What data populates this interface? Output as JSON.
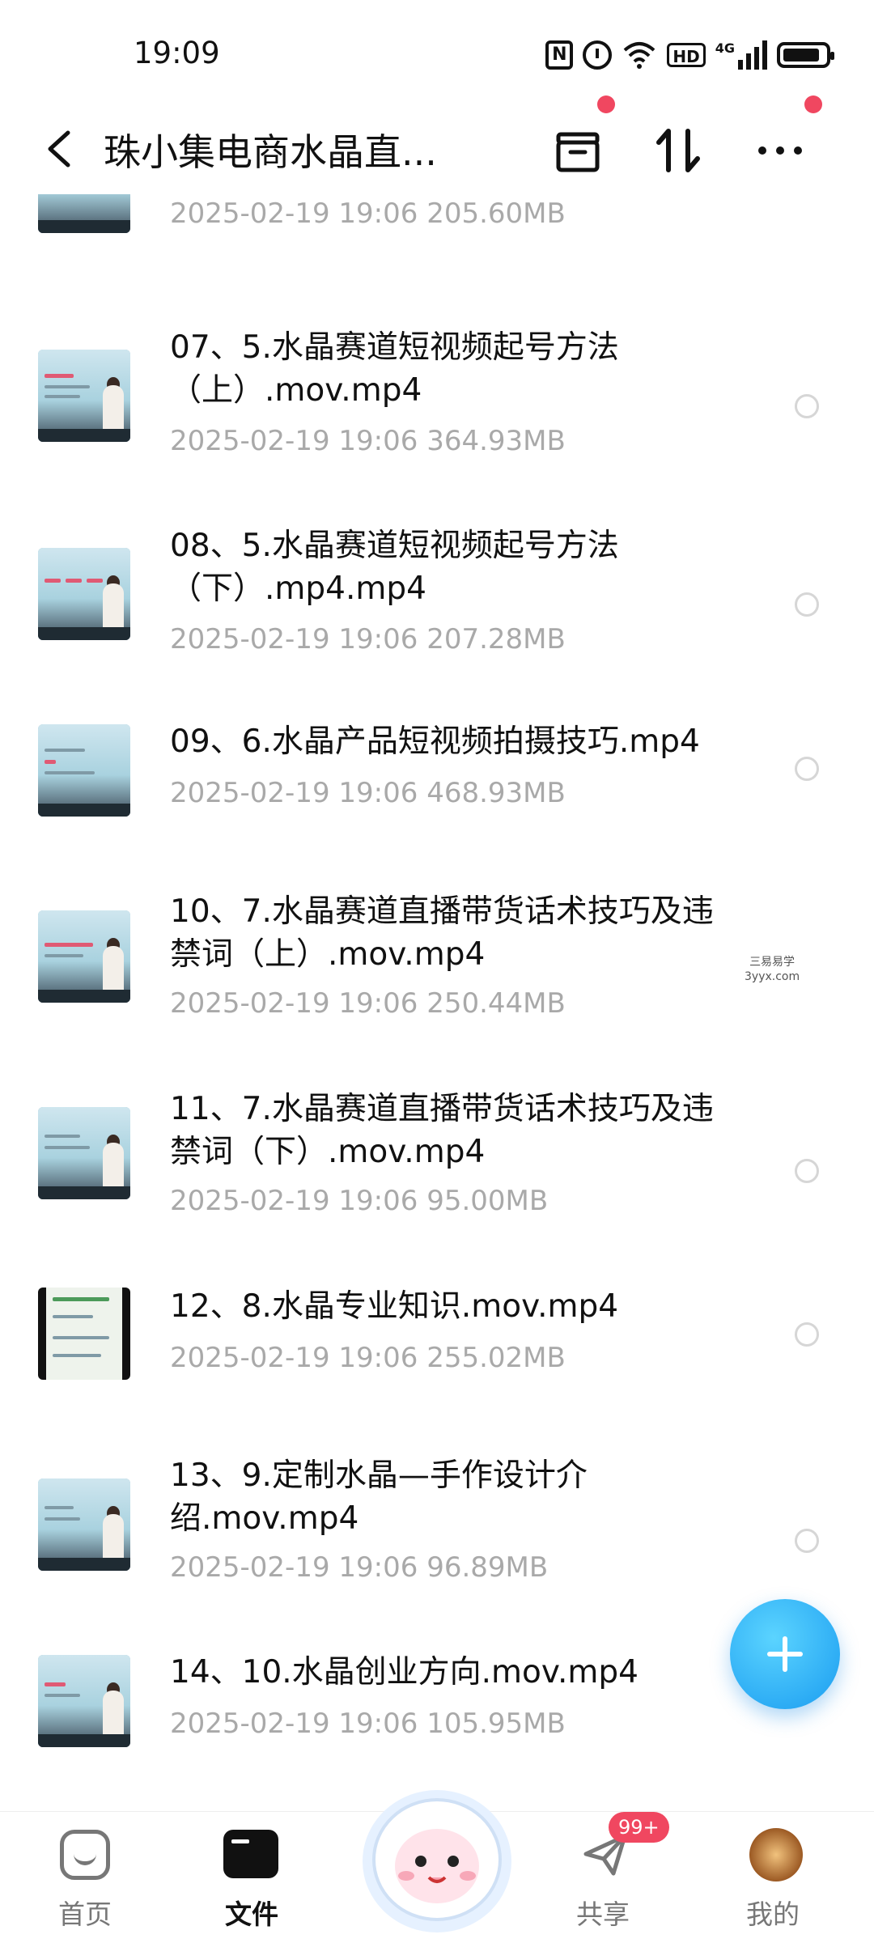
{
  "status_bar": {
    "time": "19:09",
    "icons": [
      "nfc-icon",
      "alarm-icon",
      "wifi-icon",
      "hd-icon",
      "signal-4g-icon",
      "battery-icon"
    ],
    "network_label": "4G",
    "hd_label": "HD"
  },
  "header": {
    "title": "珠小集电商水晶直...",
    "icons": [
      "back-arrow-icon",
      "archive-box-icon",
      "sort-icon",
      "more-icon"
    ]
  },
  "files": [
    {
      "name": "",
      "meta": "2025-02-19  19:06   205.60MB"
    },
    {
      "name": "07、5.水晶赛道短视频起号方法（上）.mov.mp4",
      "meta": "2025-02-19  19:06   364.93MB"
    },
    {
      "name": "08、5.水晶赛道短视频起号方法（下）.mp4.mp4",
      "meta": "2025-02-19  19:06   207.28MB"
    },
    {
      "name": "09、6.水晶产品短视频拍摄技巧.mp4",
      "meta": "2025-02-19  19:06   468.93MB"
    },
    {
      "name": "10、7.水晶赛道直播带货话术技巧及违禁词（上）.mov.mp4",
      "meta": "2025-02-19  19:06   250.44MB"
    },
    {
      "name": "11、7.水晶赛道直播带货话术技巧及违禁词（下）.mov.mp4",
      "meta": "2025-02-19  19:06   95.00MB"
    },
    {
      "name": "12、8.水晶专业知识.mov.mp4",
      "meta": "2025-02-19  19:06   255.02MB"
    },
    {
      "name": "13、9.定制水晶—手作设计介绍.mov.mp4",
      "meta": "2025-02-19  19:06   96.89MB"
    },
    {
      "name": "14、10.水晶创业方向.mov.mp4",
      "meta": "2025-02-19  19:06   105.95MB"
    }
  ],
  "watermark": {
    "line1": "三易易学",
    "line2": "3yyx.com"
  },
  "fab": {
    "icon": "plus-icon"
  },
  "bottom_nav": {
    "home": "首页",
    "files": "文件",
    "share": "共享",
    "share_badge": "99+",
    "me": "我的"
  },
  "colors": {
    "accent": "#1a9cf0",
    "badge": "#f04760",
    "meta_text": "#a9a9a9"
  }
}
